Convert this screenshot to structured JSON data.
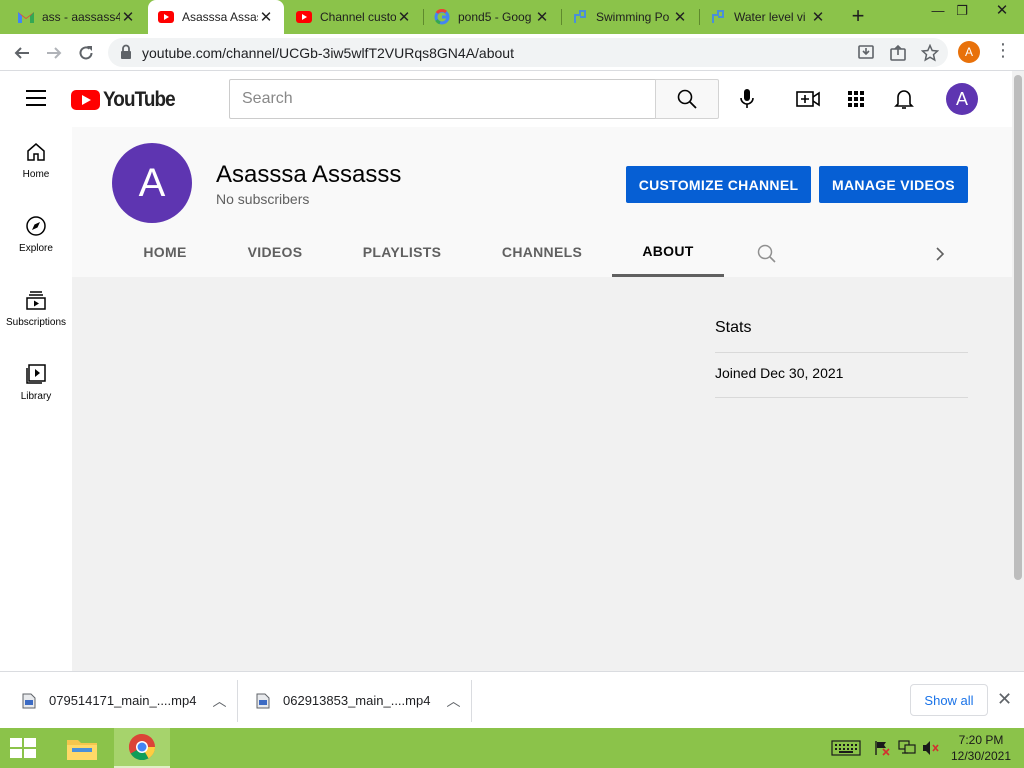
{
  "browser": {
    "tabs": [
      {
        "title": "ass - aassass4",
        "icon": "gmail-icon"
      },
      {
        "title": "Asasssa Assass",
        "icon": "youtube-icon",
        "active": true
      },
      {
        "title": "Channel custo",
        "icon": "youtube-icon"
      },
      {
        "title": "pond5 - Goog",
        "icon": "google-icon"
      },
      {
        "title": "Swimming Po",
        "icon": "pond5-icon"
      },
      {
        "title": "Water level vi",
        "icon": "pond5-icon"
      }
    ],
    "url": "youtube.com/channel/UCGb-3iw5wlfT2VURqs8GN4A/about",
    "profile_initial": "A"
  },
  "youtube": {
    "logo_text": "YouTube",
    "search_placeholder": "Search",
    "avatar_initial": "A",
    "guide": [
      {
        "label": "Home",
        "icon": "home-icon"
      },
      {
        "label": "Explore",
        "icon": "compass-icon"
      },
      {
        "label": "Subscriptions",
        "icon": "subscriptions-icon"
      },
      {
        "label": "Library",
        "icon": "library-icon"
      }
    ],
    "channel": {
      "avatar_initial": "A",
      "name": "Asasssa Assasss",
      "subscribers": "No subscribers",
      "customize_label": "CUSTOMIZE CHANNEL",
      "manage_label": "MANAGE VIDEOS",
      "tabs": [
        "HOME",
        "VIDEOS",
        "PLAYLISTS",
        "CHANNELS",
        "ABOUT"
      ],
      "active_tab": "ABOUT"
    },
    "about": {
      "stats_heading": "Stats",
      "joined": "Joined Dec 30, 2021"
    }
  },
  "downloads": {
    "items": [
      "079514171_main_....mp4",
      "062913853_main_....mp4"
    ],
    "show_all": "Show all"
  },
  "taskbar": {
    "time": "7:20 PM",
    "date": "12/30/2021"
  },
  "colors": {
    "accent_green": "#8bc34a",
    "youtube_red": "#ff0000",
    "button_blue": "#065fd4",
    "avatar_purple": "#5e35b1"
  }
}
